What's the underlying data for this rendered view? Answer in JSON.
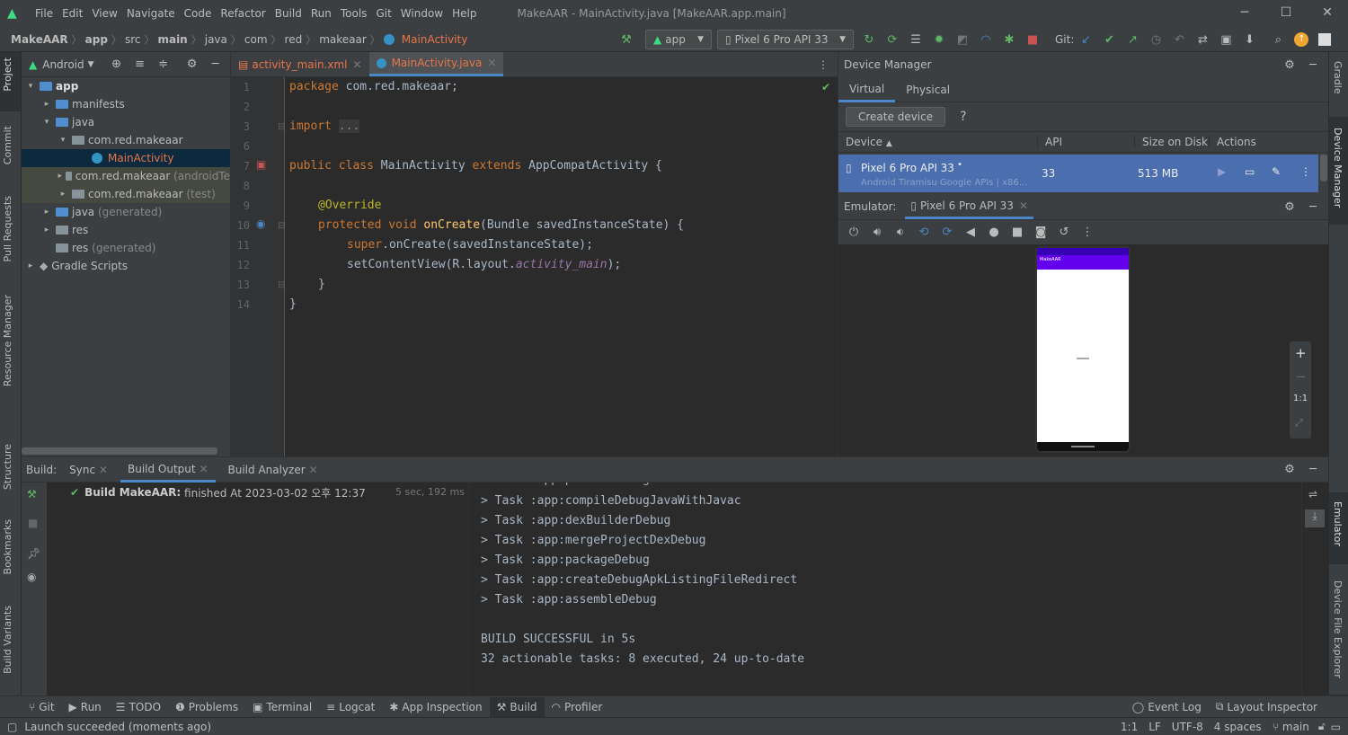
{
  "menu": [
    "File",
    "Edit",
    "View",
    "Navigate",
    "Code",
    "Refactor",
    "Build",
    "Run",
    "Tools",
    "Git",
    "Window",
    "Help"
  ],
  "window_title": "MakeAAR - MainActivity.java [MakeAAR.app.main]",
  "breadcrumb": [
    "MakeAAR",
    "app",
    "src",
    "main",
    "java",
    "com",
    "red",
    "makeaar",
    "MainActivity"
  ],
  "toolbar": {
    "run_config": "app",
    "device": "Pixel 6 Pro API 33",
    "git_label": "Git:"
  },
  "left_tabs": [
    "Project",
    "Commit",
    "Pull Requests",
    "Resource Manager",
    "Structure",
    "Bookmarks",
    "Build Variants"
  ],
  "right_tabs": [
    "Gradle",
    "Device Manager",
    "Emulator",
    "Device File Explorer"
  ],
  "project": {
    "view_mode": "Android",
    "tree": [
      {
        "label": "app",
        "sub": "",
        "level": 0,
        "arrow": "▾"
      },
      {
        "label": "manifests",
        "sub": "",
        "level": 1,
        "arrow": "▸"
      },
      {
        "label": "java",
        "sub": "",
        "level": 1,
        "arrow": "▾"
      },
      {
        "label": "com.red.makeaar",
        "sub": "",
        "level": 2,
        "arrow": "▾"
      },
      {
        "label": "MainActivity",
        "sub": "",
        "level": 3,
        "arrow": ""
      },
      {
        "label": "com.red.makeaar",
        "sub": "(androidTe",
        "level": 2,
        "arrow": "▸"
      },
      {
        "label": "com.red.makeaar",
        "sub": "(test)",
        "level": 2,
        "arrow": "▸"
      },
      {
        "label": "java",
        "sub": "(generated)",
        "level": 1,
        "arrow": "▸"
      },
      {
        "label": "res",
        "sub": "",
        "level": 1,
        "arrow": "▸"
      },
      {
        "label": "res",
        "sub": "(generated)",
        "level": 1,
        "arrow": ""
      },
      {
        "label": "Gradle Scripts",
        "sub": "",
        "level": 0,
        "arrow": "▸"
      }
    ]
  },
  "editor": {
    "tabs": [
      "activity_main.xml",
      "MainActivity.java"
    ],
    "line_numbers": [
      "1",
      "2",
      "3",
      "6",
      "7",
      "8",
      "9",
      "10",
      "11",
      "12",
      "13",
      "14"
    ],
    "lines": {
      "l1_kw": "package",
      "l1_rest": " com.red.makeaar;",
      "l3_kw": "import",
      "l3_fold": "...",
      "l7_kw": "public class",
      "l7_rest": " MainActivity ",
      "l7_kw2": "extends",
      "l7_rest2": " AppCompatActivity {",
      "l9_an": "@Override",
      "l10_kw": "protected void",
      "l10_fn": " onCreate",
      "l10_rest": "(Bundle savedInstanceState) {",
      "l11_kw": "super",
      "l11_rest": ".onCreate(savedInstanceState);",
      "l12_pre": "setContentView(R.layout.",
      "l12_it": "activity_main",
      "l12_post": ");",
      "l13": "}",
      "l14": "}"
    }
  },
  "device_manager": {
    "title": "Device Manager",
    "tabs": [
      "Virtual",
      "Physical"
    ],
    "create_button": "Create device",
    "help": "?",
    "columns": [
      "Device",
      "API",
      "Size on Disk",
      "Actions"
    ],
    "device": {
      "name": "Pixel 6 Pro API 33",
      "sub": "Android Tiramisu Google APIs | x86...",
      "api": "33",
      "size": "513 MB"
    }
  },
  "emulator": {
    "label": "Emulator:",
    "tab": "Pixel 6 Pro API 33",
    "phone_app": "MakeAAR",
    "zoom_label": "1:1"
  },
  "build": {
    "label": "Build:",
    "tabs": [
      "Sync",
      "Build Output",
      "Build Analyzer"
    ],
    "result_title": "Build MakeAAR:",
    "result_text": "finished At 2023-03-02 오후 12:37",
    "duration": "5 sec, 192 ms",
    "output": [
      "> Task :app:processDebugResources",
      "> Task :app:compileDebugJavaWithJavac",
      "> Task :app:dexBuilderDebug",
      "> Task :app:mergeProjectDexDebug",
      "> Task :app:packageDebug",
      "> Task :app:createDebugApkListingFileRedirect",
      "> Task :app:assembleDebug",
      "",
      "BUILD SUCCESSFUL in 5s",
      "32 actionable tasks: 8 executed, 24 up-to-date"
    ]
  },
  "bottom_tools": [
    "Git",
    "Run",
    "TODO",
    "Problems",
    "Terminal",
    "Logcat",
    "App Inspection",
    "Build",
    "Profiler"
  ],
  "bottom_right": [
    "Event Log",
    "Layout Inspector"
  ],
  "status": {
    "message": "Launch succeeded (moments ago)",
    "position": "1:1",
    "line_sep": "LF",
    "encoding": "UTF-8",
    "indent": "4 spaces",
    "branch": "main"
  },
  "colors": {
    "accent": "#4a88c7",
    "selection": "#0d293e",
    "device_row": "#4b6eaf",
    "android_green": "#3ddc84",
    "phone_bar": "#6200ee"
  }
}
